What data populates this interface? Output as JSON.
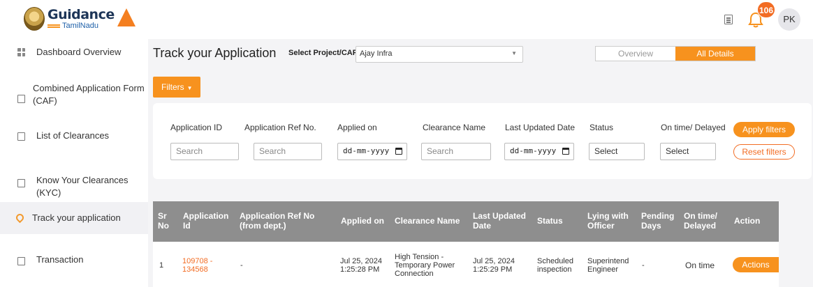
{
  "header": {
    "logo_title": "Guidance",
    "logo_sub": "TamilNadu",
    "notification_count": "106",
    "avatar_initials": "PK"
  },
  "sidebar": {
    "items": [
      {
        "label": "Dashboard Overview",
        "icon": "dashboard-icon"
      },
      {
        "label": "Combined Application Form (CAF)",
        "icon": "document-icon"
      },
      {
        "label": "List of Clearances",
        "icon": "list-icon"
      },
      {
        "label": "Know Your Clearances (KYC)",
        "icon": "book-icon"
      },
      {
        "label": "Track your application",
        "icon": "location-pin-icon",
        "active": true
      },
      {
        "label": "Transaction",
        "icon": "transaction-icon"
      }
    ]
  },
  "main": {
    "title": "Track your Application",
    "select_label": "Select Project/CAF",
    "select_value": "Ajay Infra",
    "view_toggle": [
      "Overview",
      "All Details"
    ],
    "filters_label": "Filters"
  },
  "filters": {
    "fields": [
      {
        "label": "Application ID",
        "placeholder": "Search"
      },
      {
        "label": "Application Ref No.",
        "placeholder": "Search"
      },
      {
        "label": "Applied on",
        "placeholder": "dd-mm-yyyy"
      },
      {
        "label": "Clearance Name",
        "placeholder": "Search"
      },
      {
        "label": "Last Updated Date",
        "placeholder": "dd-mm-yyyy"
      },
      {
        "label": "Status",
        "placeholder": "Select"
      },
      {
        "label": "On time/ Delayed",
        "placeholder": "Select"
      }
    ],
    "apply_label": "Apply filters",
    "reset_label": "Reset filters"
  },
  "table": {
    "columns": [
      "Sr No",
      "Application Id",
      "Application Ref No (from dept.)",
      "Applied on",
      "Clearance Name",
      "Last Updated Date",
      "Status",
      "Lying with Officer",
      "Pending Days",
      "On time/ Delayed",
      "Action"
    ],
    "rows": [
      {
        "sr": "1",
        "app_id": "109708 - 134568",
        "ref_no": "-",
        "applied_on": "Jul 25, 2024 1:25:28 PM",
        "clearance": "High Tension - Temporary Power Connection",
        "last_updated": "Jul 25, 2024 1:25:29 PM",
        "status": "Scheduled inspection",
        "officer": "Superintend Engineer",
        "pending_days": "-",
        "on_time": "On time",
        "action": "Actions"
      }
    ]
  },
  "colors": {
    "accent": "#f7921e",
    "header_gray": "#8e8e8e",
    "link": "#f26c23"
  }
}
